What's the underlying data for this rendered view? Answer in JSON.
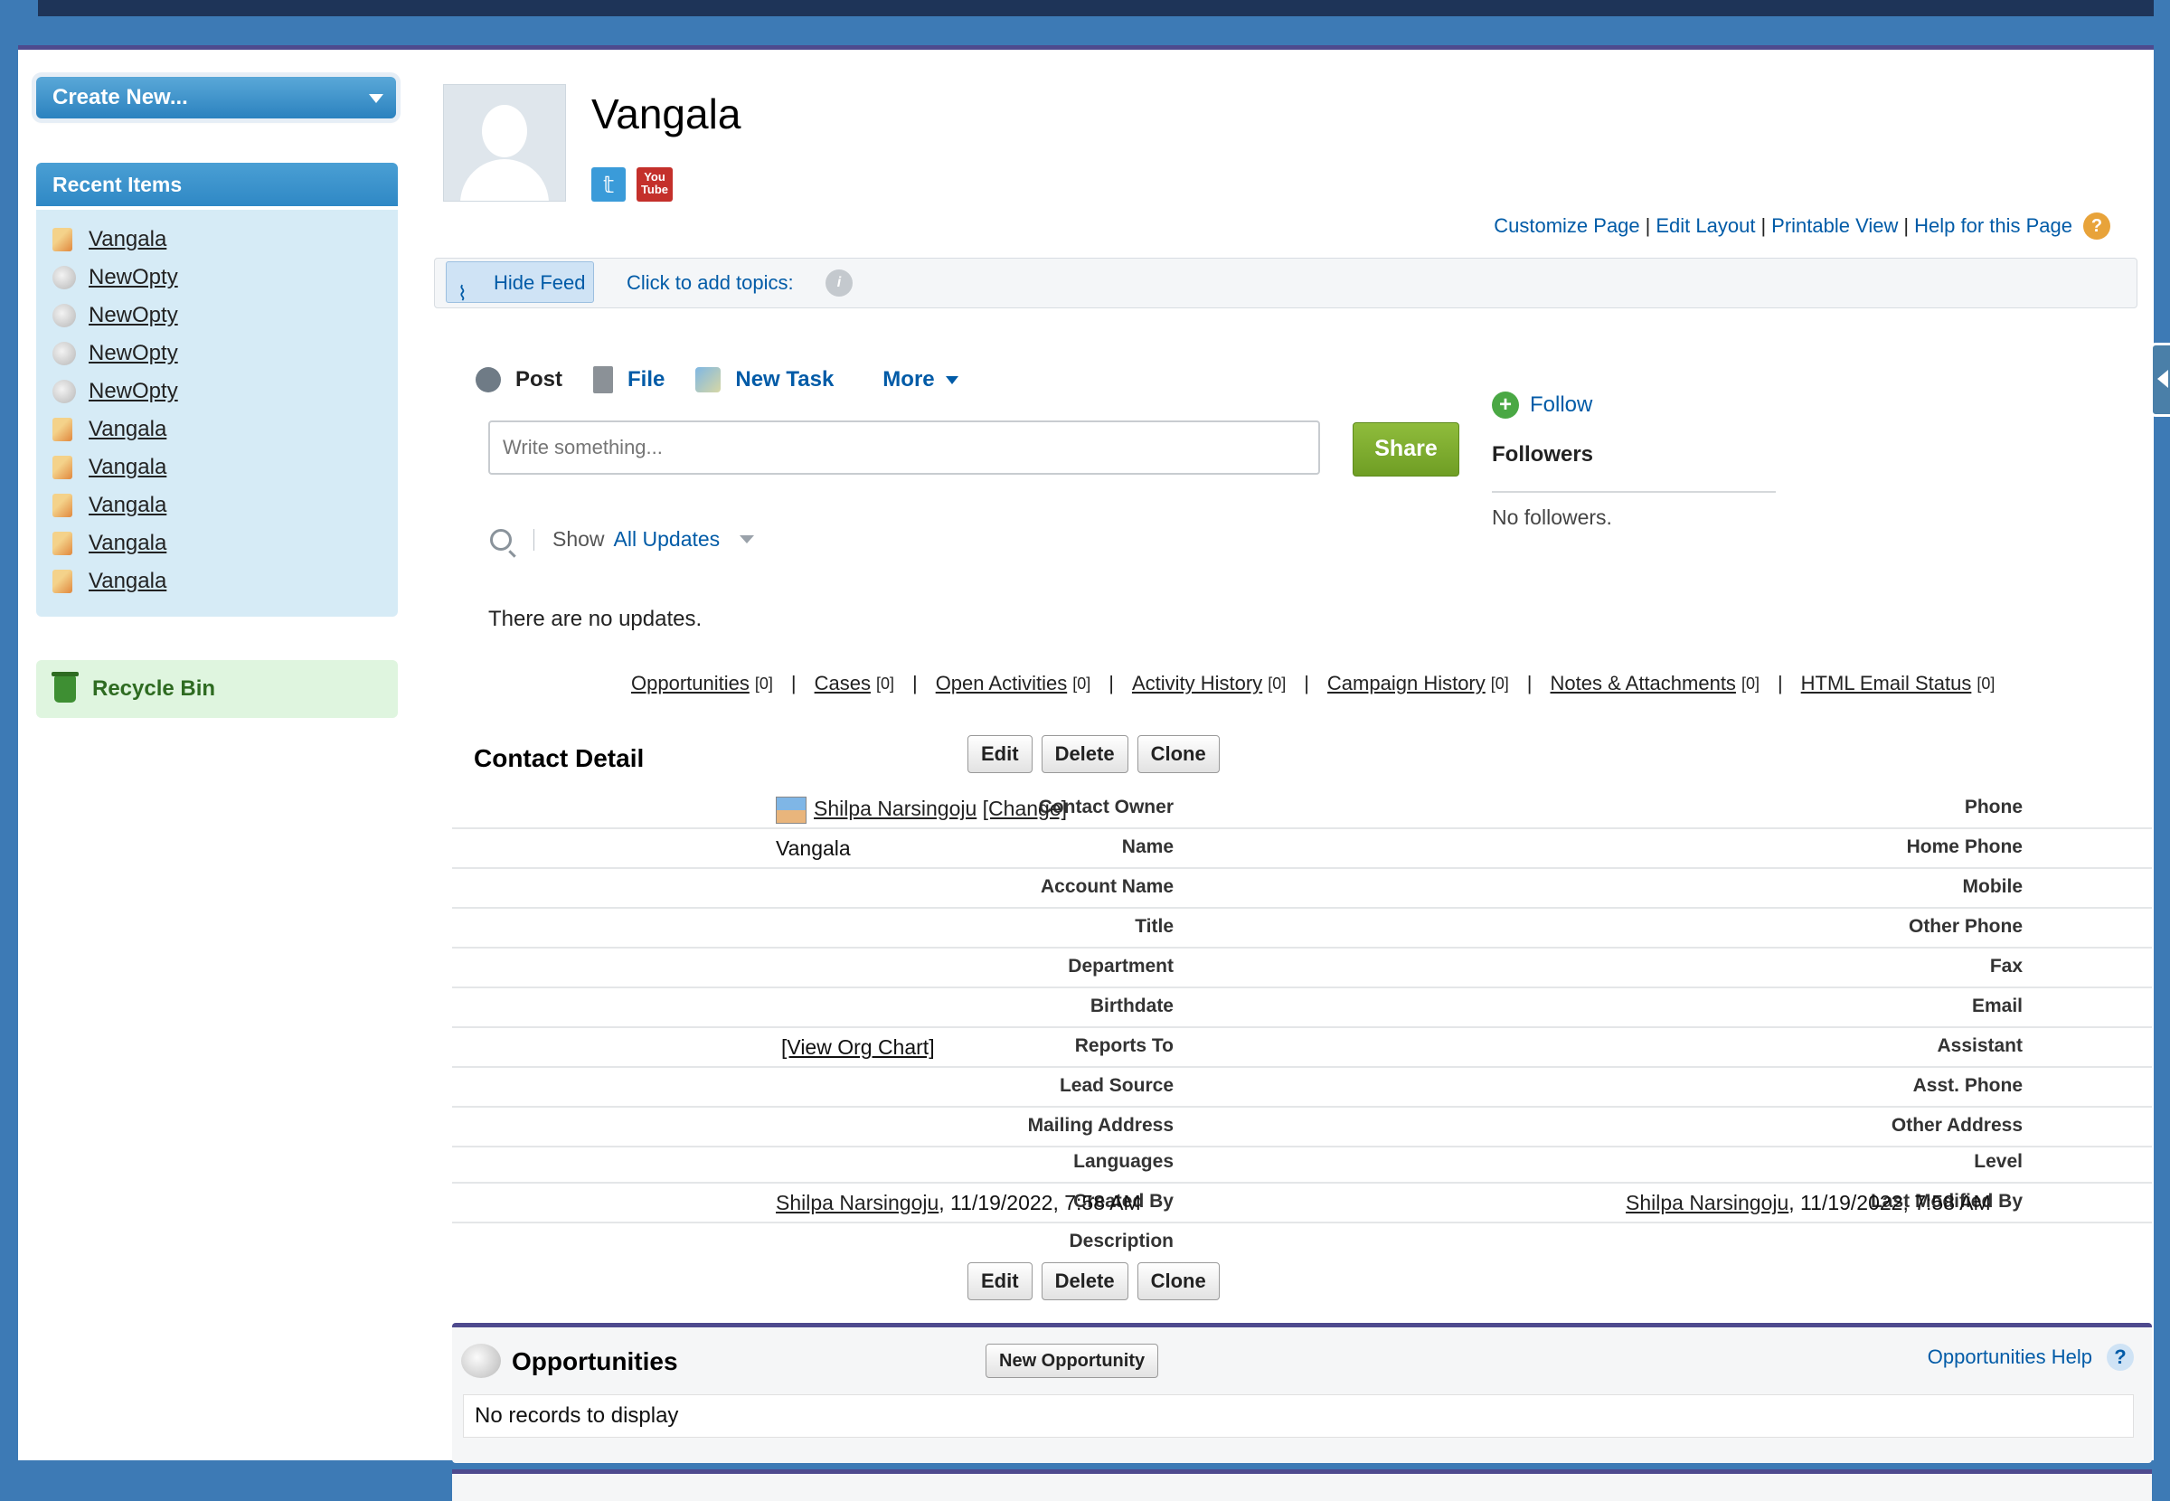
{
  "sidebar": {
    "create_new": "Create New...",
    "recent_items_title": "Recent Items",
    "recent_items": [
      {
        "label": "Vangala",
        "type": "contact"
      },
      {
        "label": "NewOpty",
        "type": "opportunity"
      },
      {
        "label": "NewOpty",
        "type": "opportunity"
      },
      {
        "label": "NewOpty",
        "type": "opportunity"
      },
      {
        "label": "NewOpty",
        "type": "opportunity"
      },
      {
        "label": "Vangala",
        "type": "contact"
      },
      {
        "label": "Vangala",
        "type": "contact"
      },
      {
        "label": "Vangala",
        "type": "contact"
      },
      {
        "label": "Vangala",
        "type": "contact"
      },
      {
        "label": "Vangala",
        "type": "contact"
      }
    ],
    "recycle_bin": "Recycle Bin"
  },
  "header": {
    "contact_name": "Vangala",
    "links": {
      "customize": "Customize Page",
      "edit_layout": "Edit Layout",
      "printable": "Printable View",
      "help": "Help for this Page",
      "sep": "|"
    }
  },
  "feed": {
    "hide_feed": "Hide Feed",
    "add_topics": "Click to add topics:",
    "tabs": {
      "post": "Post",
      "file": "File",
      "new_task": "New Task",
      "more": "More"
    },
    "input_placeholder": "Write something...",
    "share": "Share",
    "follow": "Follow",
    "followers_title": "Followers",
    "no_followers": "No followers.",
    "show_label": "Show",
    "show_value": "All Updates",
    "no_updates": "There are no updates."
  },
  "related_links": [
    {
      "label": "Opportunities",
      "count": "[0]"
    },
    {
      "label": "Cases",
      "count": "[0]"
    },
    {
      "label": "Open Activities",
      "count": "[0]"
    },
    {
      "label": "Activity History",
      "count": "[0]"
    },
    {
      "label": "Campaign History",
      "count": "[0]"
    },
    {
      "label": "Notes & Attachments",
      "count": "[0]"
    },
    {
      "label": "HTML Email Status",
      "count": "[0]"
    }
  ],
  "detail": {
    "title": "Contact Detail",
    "buttons": {
      "edit": "Edit",
      "delete": "Delete",
      "clone": "Clone"
    },
    "fields": {
      "contact_owner": {
        "label": "Contact Owner",
        "name": "Shilpa Narsingoju",
        "change": "[Change]"
      },
      "phone": {
        "label": "Phone"
      },
      "name": {
        "label": "Name",
        "value": "Vangala"
      },
      "home_phone": {
        "label": "Home Phone"
      },
      "account_name": {
        "label": "Account Name"
      },
      "mobile": {
        "label": "Mobile"
      },
      "title": {
        "label": "Title"
      },
      "other_phone": {
        "label": "Other Phone"
      },
      "department": {
        "label": "Department"
      },
      "fax": {
        "label": "Fax"
      },
      "birthdate": {
        "label": "Birthdate"
      },
      "email": {
        "label": "Email"
      },
      "reports_to": {
        "label": "Reports To",
        "value": "[View Org Chart]"
      },
      "assistant": {
        "label": "Assistant"
      },
      "lead_source": {
        "label": "Lead Source"
      },
      "asst_phone": {
        "label": "Asst. Phone"
      },
      "mailing_address": {
        "label": "Mailing Address"
      },
      "other_address": {
        "label": "Other Address"
      },
      "languages": {
        "label": "Languages"
      },
      "level": {
        "label": "Level"
      },
      "created_by": {
        "label": "Created By",
        "user": "Shilpa Narsingoju",
        "date": ", 11/19/2022, 7:58 AM"
      },
      "last_modified_by": {
        "label": "Last Modified By",
        "user": "Shilpa Narsingoju",
        "date": ", 11/19/2022, 7:58 AM"
      },
      "description": {
        "label": "Description"
      }
    }
  },
  "opportunities": {
    "title": "Opportunities",
    "new_button": "New Opportunity",
    "help": "Opportunities Help",
    "empty": "No records to display"
  }
}
